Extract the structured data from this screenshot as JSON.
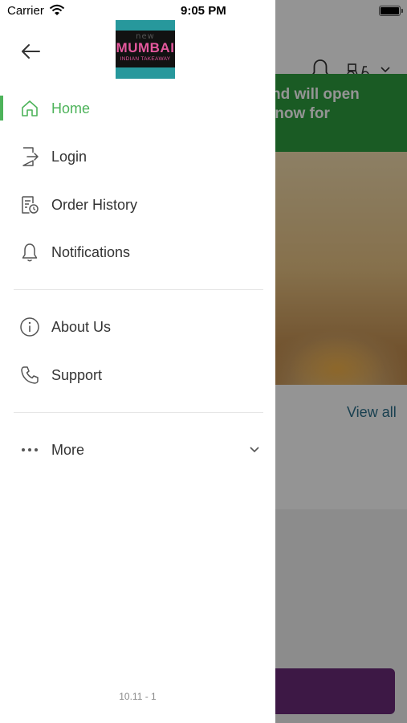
{
  "status_bar": {
    "carrier": "Carrier",
    "time": "9:05 PM"
  },
  "logo": {
    "top": "new",
    "name": "MUMBAI",
    "subtitle": "INDIAN TAKEAWAY"
  },
  "menu": {
    "items": [
      {
        "label": "Home",
        "icon": "home-icon",
        "active": true
      },
      {
        "label": "Login",
        "icon": "login-icon",
        "active": false
      },
      {
        "label": "Order History",
        "icon": "order-history-icon",
        "active": false
      },
      {
        "label": "Notifications",
        "icon": "bell-icon",
        "active": false
      }
    ],
    "secondary": [
      {
        "label": "About Us",
        "icon": "info-icon"
      },
      {
        "label": "Support",
        "icon": "phone-icon"
      }
    ],
    "more_label": "More"
  },
  "version": "10.11 - 1",
  "background": {
    "banner_line1": "ed and will open",
    "banner_line2": "rder now for",
    "view_all": "View all"
  },
  "colors": {
    "accent": "#4db35a",
    "banner": "#2e9e3f",
    "cta": "#6a2a77",
    "link": "#2b6f8a"
  }
}
